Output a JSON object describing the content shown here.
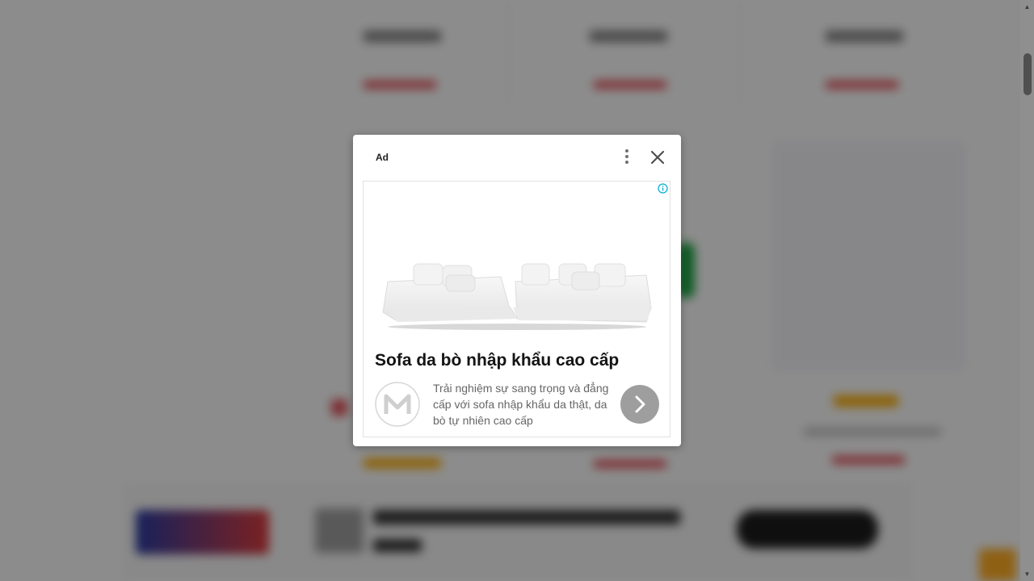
{
  "ad": {
    "label": "Ad",
    "headline": "Sofa da bò nhập khẩu cao cấp",
    "body": "Trải nghiệm sự sang trọng và đẳng cấp với sofa nhập khẩu da thật, da bò tự nhiên cao cấp",
    "menu_icon": "more-vert-icon",
    "close_icon": "close-icon",
    "info_icon": "info-icon",
    "logo_icon": "brand-m-logo",
    "cta_icon": "chevron-right-icon"
  },
  "colors": {
    "overlay": "#000000",
    "dialog_bg": "#ffffff",
    "headline": "#141414",
    "body_text": "#666666",
    "cta_bg": "#9e9e9e",
    "info_accent": "#00aecd"
  }
}
